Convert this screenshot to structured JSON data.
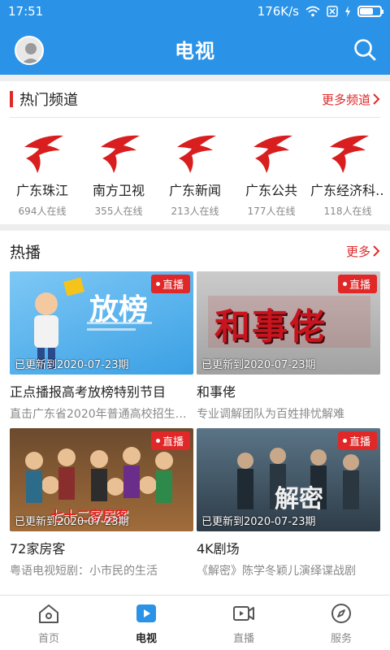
{
  "status": {
    "time": "17:51",
    "speed": "176K/s"
  },
  "header": {
    "title": "电视"
  },
  "hot_channels": {
    "title": "热门频道",
    "more": "更多频道",
    "items": [
      {
        "name": "广东珠江",
        "viewers": "694人在线"
      },
      {
        "name": "南方卫视",
        "viewers": "355人在线"
      },
      {
        "name": "广东新闻",
        "viewers": "213人在线"
      },
      {
        "name": "广东公共",
        "viewers": "177人在线"
      },
      {
        "name": "广东经济科…",
        "viewers": "118人在线"
      }
    ]
  },
  "hot_play": {
    "title": "热播",
    "more": "更多",
    "items": [
      {
        "badge": "直播",
        "updated": "已更新到2020-07-23期",
        "title": "正点播报高考放榜特别节目",
        "desc": "直击广东省2020年普通高校招生…",
        "thumb_text": "放榜"
      },
      {
        "badge": "直播",
        "updated": "已更新到2020-07-23期",
        "title": "和事佬",
        "desc": "专业调解团队为百姓排忧解难",
        "thumb_text": "和事佬"
      },
      {
        "badge": "直播",
        "updated": "已更新到2020-07-23期",
        "title": "72家房客",
        "desc": "粤语电视短剧：小市民的生活",
        "thumb_text": "七十二家房客"
      },
      {
        "badge": "直播",
        "updated": "已更新到2020-07-23期",
        "title": "4K剧场",
        "desc": "《解密》陈学冬颖儿演绎谍战剧",
        "thumb_text": "解密"
      }
    ]
  },
  "nav": {
    "items": [
      {
        "label": "首页",
        "icon": "home-icon"
      },
      {
        "label": "电视",
        "icon": "tv-play-icon"
      },
      {
        "label": "直播",
        "icon": "live-camera-icon"
      },
      {
        "label": "服务",
        "icon": "compass-icon"
      }
    ],
    "active": 1
  },
  "colors": {
    "accent": "#2a93e8",
    "red": "#e02828"
  }
}
